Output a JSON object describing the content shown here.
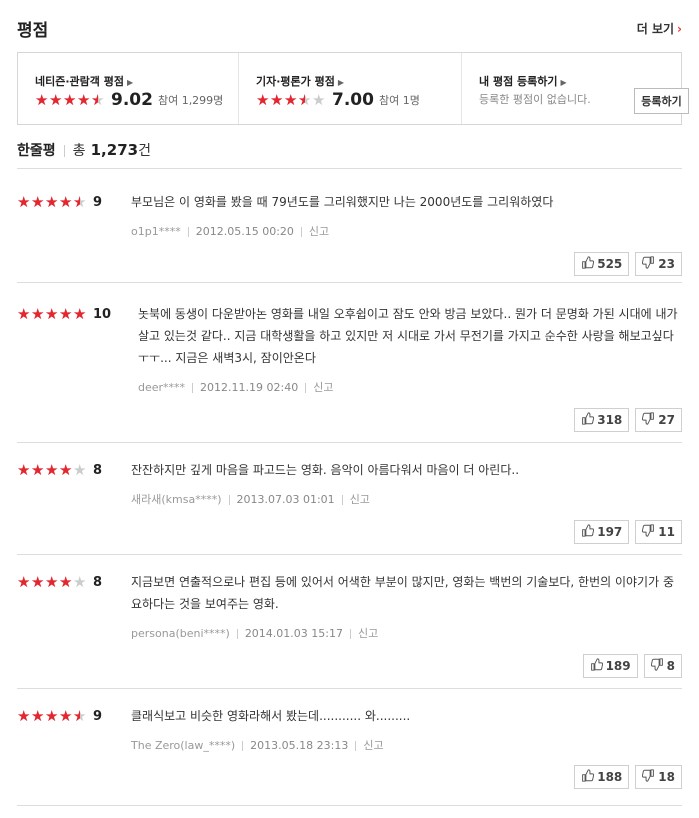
{
  "header": {
    "title": "평점",
    "more_label": "더 보기"
  },
  "scores": {
    "audience": {
      "title": "네티즌·관람객 평점",
      "score": "9.02",
      "count": "참여 1,299명",
      "rating": 9.02
    },
    "critics": {
      "title": "기자·평론가 평점",
      "score": "7.00",
      "count": "참여 1명",
      "rating": 7.0
    },
    "mine": {
      "title": "내 평점 등록하기",
      "message": "등록한 평점이 없습니다.",
      "button": "등록하기"
    }
  },
  "oneline": {
    "label": "한줄평",
    "total_prefix": "총",
    "total_count": "1,273",
    "total_suffix": "건"
  },
  "reviews": [
    {
      "rating": 9,
      "score": "9",
      "text": "부모님은 이 영화를 봤을 때 79년도를 그리워했지만 나는 2000년도를 그리워하였다",
      "user": "o1p1****",
      "date": "2012.05.15 00:20",
      "report": "신고",
      "likes": "525",
      "dislikes": "23"
    },
    {
      "rating": 10,
      "score": "10",
      "text": "놋북에 동생이 다운받아논 영화를 내일 오후쉽이고 잠도 안와 방금 보았다.. 뭔가 더 문명화 가된 시대에 내가 살고 있는것 같다.. 지금 대학생활을 하고 있지만 저 시대로 가서 무전기를 가지고 순수한 사랑을 해보고싶다ㅜㅜ... 지금은 새벽3시, 잠이안온다",
      "user": "deer****",
      "date": "2012.11.19 02:40",
      "report": "신고",
      "likes": "318",
      "dislikes": "27"
    },
    {
      "rating": 8,
      "score": "8",
      "text": "잔잔하지만 깊게 마음을 파고드는 영화. 음악이 아름다워서 마음이 더 아린다..",
      "user": "새라새(kmsa****)",
      "date": "2013.07.03 01:01",
      "report": "신고",
      "likes": "197",
      "dislikes": "11"
    },
    {
      "rating": 8,
      "score": "8",
      "text": "지금보면 연출적으로나 편집 등에 있어서 어색한 부분이 많지만, 영화는 백번의 기술보다, 한번의 이야기가 중요하다는 것을 보여주는 영화.",
      "user": "persona(beni****)",
      "date": "2014.01.03 15:17",
      "report": "신고",
      "likes": "189",
      "dislikes": "8"
    },
    {
      "rating": 9,
      "score": "9",
      "text": "클래식보고 비슷한 영화라해서 봤는데........... 와.........",
      "user": "The Zero(law_****)",
      "date": "2013.05.18 23:13",
      "report": "신고",
      "likes": "188",
      "dislikes": "18"
    }
  ],
  "icons": {
    "like": "thumbs-up-icon",
    "dislike": "thumbs-down-icon",
    "star": "star-icon",
    "chevron": "chevron-right-icon"
  },
  "colors": {
    "star": "#e5262f",
    "star_empty": "#cccccc",
    "accent": "#e53935"
  }
}
